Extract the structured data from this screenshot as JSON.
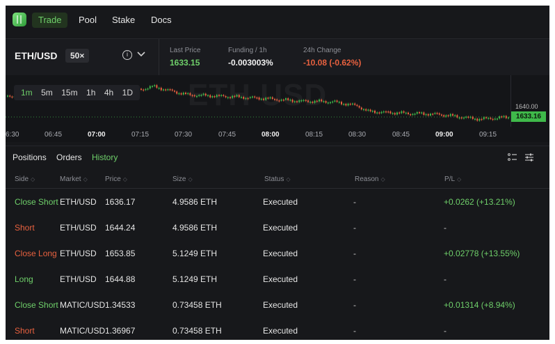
{
  "nav": {
    "items": [
      {
        "label": "Trade",
        "active": true
      },
      {
        "label": "Pool",
        "active": false
      },
      {
        "label": "Stake",
        "active": false
      },
      {
        "label": "Docs",
        "active": false
      }
    ]
  },
  "market": {
    "pair": "ETH/USD",
    "leverage": "50×",
    "info_glyph": "i",
    "last_price_label": "Last Price",
    "last_price": "1633.15",
    "funding_label": "Funding / 1h",
    "funding": "-0.003003%",
    "change_label": "24h Change",
    "change": "-10.08 (-0.62%)"
  },
  "chart": {
    "timeframes": [
      "1m",
      "5m",
      "15m",
      "1h",
      "4h",
      "1D"
    ],
    "active_timeframe": "1m",
    "watermark": "ETH USD",
    "price_label": "1640.00",
    "current_price_label": "1633.16",
    "time_labels": [
      {
        "text": "6:30",
        "bold": false
      },
      {
        "text": "06:45",
        "bold": false
      },
      {
        "text": "07:00",
        "bold": true
      },
      {
        "text": "07:15",
        "bold": false
      },
      {
        "text": "07:30",
        "bold": false
      },
      {
        "text": "07:45",
        "bold": false
      },
      {
        "text": "08:00",
        "bold": true
      },
      {
        "text": "08:15",
        "bold": false
      },
      {
        "text": "08:30",
        "bold": false
      },
      {
        "text": "08:45",
        "bold": false
      },
      {
        "text": "09:00",
        "bold": true
      },
      {
        "text": "09:15",
        "bold": false
      }
    ],
    "colors": {
      "up": "#3fb94a",
      "down": "#e8613f"
    }
  },
  "tabs": [
    {
      "label": "Positions",
      "active": false
    },
    {
      "label": "Orders",
      "active": false
    },
    {
      "label": "History",
      "active": true
    }
  ],
  "table": {
    "headers": [
      "Side",
      "Market",
      "Price",
      "Size",
      "Status",
      "Reason",
      "P/L"
    ],
    "sort_glyph": "◇",
    "rows": [
      {
        "side": "Close Short",
        "side_color": "green",
        "market": "ETH/USD",
        "price": "1636.17",
        "size": "4.9586 ETH",
        "status": "Executed",
        "reason": "-",
        "pl": "+0.0262 (+13.21%)"
      },
      {
        "side": "Short",
        "side_color": "red",
        "market": "ETH/USD",
        "price": "1644.24",
        "size": "4.9586 ETH",
        "status": "Executed",
        "reason": "-",
        "pl": "-"
      },
      {
        "side": "Close Long",
        "side_color": "red",
        "market": "ETH/USD",
        "price": "1653.85",
        "size": "5.1249 ETH",
        "status": "Executed",
        "reason": "-",
        "pl": "+0.02778 (+13.55%)"
      },
      {
        "side": "Long",
        "side_color": "green",
        "market": "ETH/USD",
        "price": "1644.88",
        "size": "5.1249 ETH",
        "status": "Executed",
        "reason": "-",
        "pl": "-"
      },
      {
        "side": "Close Short",
        "side_color": "green",
        "market": "MATIC/USD",
        "price": "1.34533",
        "size": "0.73458 ETH",
        "status": "Executed",
        "reason": "-",
        "pl": "+0.01314 (+8.94%)"
      },
      {
        "side": "Short",
        "side_color": "red",
        "market": "MATIC/USD",
        "price": "1.36967",
        "size": "0.73458 ETH",
        "status": "Executed",
        "reason": "-",
        "pl": "-"
      }
    ]
  }
}
